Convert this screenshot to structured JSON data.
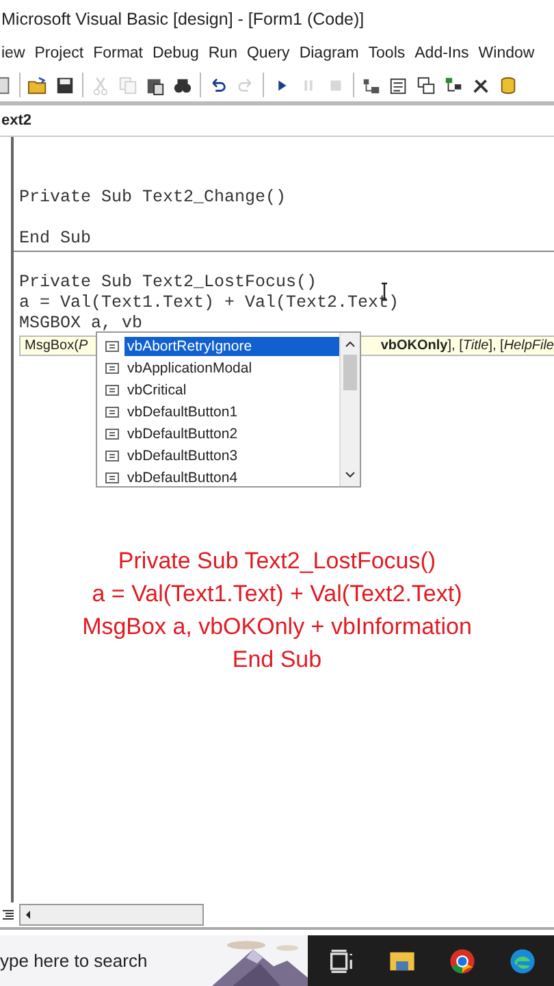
{
  "window": {
    "title": "Microsoft Visual Basic [design] - [Form1 (Code)]"
  },
  "menu": [
    "iew",
    "Project",
    "Format",
    "Debug",
    "Run",
    "Query",
    "Diagram",
    "Tools",
    "Add-Ins",
    "Window"
  ],
  "toolbar": [
    {
      "kind": "doc",
      "disabled": false
    },
    {
      "kind": "open",
      "disabled": false
    },
    {
      "kind": "save",
      "disabled": false
    },
    {
      "kind": "cut",
      "disabled": true
    },
    {
      "kind": "copy",
      "disabled": true
    },
    {
      "kind": "paste",
      "disabled": false
    },
    {
      "kind": "find",
      "disabled": false
    },
    {
      "kind": "undo",
      "disabled": false
    },
    {
      "kind": "redo",
      "disabled": true
    },
    {
      "kind": "play",
      "disabled": false
    },
    {
      "kind": "pause",
      "disabled": true
    },
    {
      "kind": "stop",
      "disabled": true
    },
    {
      "kind": "explorer",
      "disabled": false
    },
    {
      "kind": "props",
      "disabled": false
    },
    {
      "kind": "layout",
      "disabled": false
    },
    {
      "kind": "tree",
      "disabled": false
    },
    {
      "kind": "tools",
      "disabled": false
    },
    {
      "kind": "data",
      "disabled": false
    }
  ],
  "object_box": "ext2",
  "code": {
    "blocks": [
      [
        "Private Sub Text2_Change()",
        "End Sub"
      ],
      [
        "Private Sub Text2_LostFocus()",
        "a = Val(Text1.Text) + Val(Text2.Text)",
        "MSGBOX a, vb"
      ]
    ]
  },
  "tooltip": {
    "left": "MsgBox(*P*",
    "right": "**vbOKOnly**], [*Title*], [*HelpFile*"
  },
  "completion": [
    {
      "label": "vbAbortRetryIgnore",
      "selected": true
    },
    {
      "label": "vbApplicationModal",
      "selected": false
    },
    {
      "label": "vbCritical",
      "selected": false
    },
    {
      "label": "vbDefaultButton1",
      "selected": false
    },
    {
      "label": "vbDefaultButton2",
      "selected": false
    },
    {
      "label": "vbDefaultButton3",
      "selected": false
    },
    {
      "label": "vbDefaultButton4",
      "selected": false
    }
  ],
  "overlay_caption": [
    "Private Sub Text2_LostFocus()",
    "a = Val(Text1.Text) + Val(Text2.Text)",
    "MsgBox a, vbOKOnly + vbInformation",
    "End Sub"
  ],
  "taskbar": {
    "search": {
      "placeholder": "ype here to search"
    }
  }
}
